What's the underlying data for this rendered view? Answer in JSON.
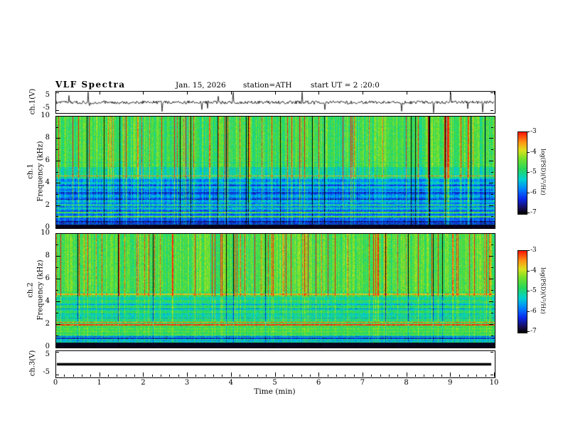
{
  "header": {
    "title": "VLF  Spectra",
    "date": "Jan. 15, 2026",
    "station": "station=ATH",
    "start_ut": "start UT =  2 :20:0"
  },
  "panels": {
    "wave1": {
      "label": "ch.1(V)",
      "yticks": [
        "5",
        "-5"
      ]
    },
    "spec1": {
      "channel": "ch.1",
      "axis": "Frequency (kHz)",
      "yticks": [
        "0",
        "2",
        "4",
        "6",
        "8",
        "10"
      ]
    },
    "spec2": {
      "channel": "ch.2",
      "axis": "Frequency (kHz)",
      "yticks": [
        "0",
        "2",
        "4",
        "6",
        "8",
        "10"
      ]
    },
    "wave3": {
      "label": "ch.3(V)",
      "yticks": [
        "5",
        "-5"
      ]
    }
  },
  "xaxis": {
    "label": "Time (min)",
    "ticks": [
      "0",
      "1",
      "2",
      "3",
      "4",
      "5",
      "6",
      "7",
      "8",
      "9",
      "10"
    ]
  },
  "colorbar": {
    "label": "log(PSD)(V²/Hz)",
    "ticks": [
      "-3",
      "-4",
      "-5",
      "-6",
      "-7"
    ],
    "colors_top_to_bottom": [
      "#ff1a0a",
      "#ff9614",
      "#dce11e",
      "#28d75a",
      "#00d2d2",
      "#0a28eb",
      "#000000"
    ]
  },
  "chart_data": [
    {
      "type": "line",
      "name": "ch1_waveform",
      "title": "ch.1(V)",
      "x_range": [
        0,
        10
      ],
      "ylim": [
        -5,
        5
      ],
      "description": "Broadband noisy voltage trace centered near 0 V with many impulsive spikes in both directions, some reaching the ±5 V panel edges, continuous for the full 0–10 min record."
    },
    {
      "type": "heatmap",
      "name": "ch1_spectrogram",
      "xlabel": "Time (min)",
      "ylabel": "Frequency (kHz)",
      "x_range": [
        0,
        10
      ],
      "y_range": [
        0,
        10
      ],
      "z_label": "log(PSD)(V²/Hz)",
      "z_range": [
        -7,
        -3
      ],
      "description": "VLF spectrogram: green background (≈ -5) above ~5 kHz crossed by dense vertical impulsive streaks reaching -3 (yellow/orange/red) plus occasional near-black vertical dropouts; 2–4.5 kHz band is bluer (≈ -6) with horizontal striping; bright horizontal emission lines near 1.0, 1.5, 1.9, 2.1 and 4.7 kHz; solid black band below ≈0.35 kHz."
    },
    {
      "type": "heatmap",
      "name": "ch2_spectrogram",
      "xlabel": "Time (min)",
      "ylabel": "Frequency (kHz)",
      "x_range": [
        0,
        10
      ],
      "y_range": [
        0,
        10
      ],
      "z_label": "log(PSD)(V²/Hz)",
      "z_range": [
        -7,
        -3
      ],
      "description": "Mostly green (≈ -4.5 to -5) with vertical yellow streaks and sparse black vertical lines above ~4.5 kHz; intense red/orange horizontal emission lines near 2.0–2.25 kHz; faint orange line near 4.7 kHz; thin dark horizontal lines between ~2.6 and 4.2 kHz and near 0.85 kHz; solid black band below ≈0.45 kHz."
    },
    {
      "type": "line",
      "name": "ch3_waveform",
      "title": "ch.3(V)",
      "x_range": [
        0,
        10
      ],
      "ylim": [
        -5,
        5
      ],
      "description": "Flat heavy black line at 0 V (channel silent), extending from 0 to ≈9.8 min."
    }
  ]
}
